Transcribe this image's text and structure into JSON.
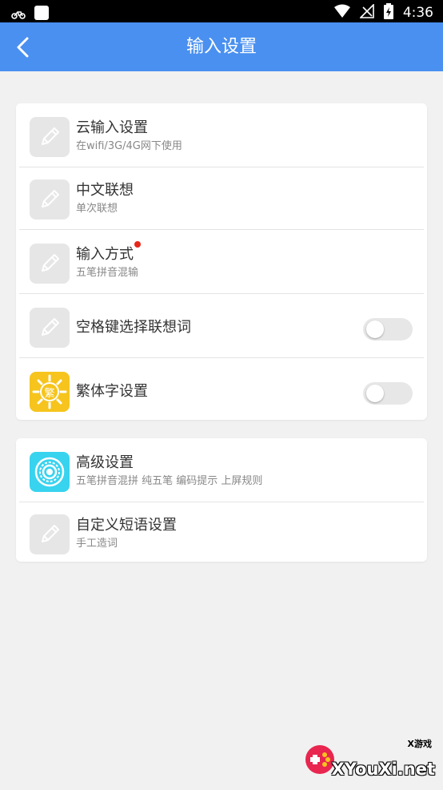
{
  "status_bar": {
    "time": "4:36",
    "left_icons": [
      "bike-icon",
      "app-square-icon"
    ],
    "right_icons": [
      "wifi-icon",
      "no-signal-icon",
      "battery-charging-icon"
    ]
  },
  "app_bar": {
    "title": "输入设置",
    "back_icon": "chevron-left-icon",
    "color": "#4a90f0"
  },
  "group1": [
    {
      "label": "云输入设置",
      "sub": "在wifi/3G/4G网下使用",
      "icon": "pencil-icon"
    },
    {
      "label": "中文联想",
      "sub": "单次联想",
      "icon": "pencil-icon"
    },
    {
      "label": "输入方式",
      "sub": "五笔拼音混输",
      "icon": "pencil-icon",
      "badge": "red-dot"
    },
    {
      "label": "空格键选择联想词",
      "icon": "pencil-icon",
      "toggle": false
    },
    {
      "label": "繁体字设置",
      "icon": "traditional-char-icon",
      "icon_char": "繁",
      "toggle": false
    }
  ],
  "group2": [
    {
      "label": "高级设置",
      "sub": "五笔拼音混拼 纯五笔 编码提示 上屏规则",
      "icon": "settings-gear-icon"
    },
    {
      "label": "自定义短语设置",
      "sub": "手工造词",
      "icon": "pencil-icon"
    }
  ],
  "watermark": {
    "brand": "XYouXi.net",
    "tag": "X游戏"
  },
  "colors": {
    "accent": "#4a90f0",
    "badge": "#e8261a",
    "yellow": "#f6c41d",
    "teal": "#38d3ef"
  }
}
